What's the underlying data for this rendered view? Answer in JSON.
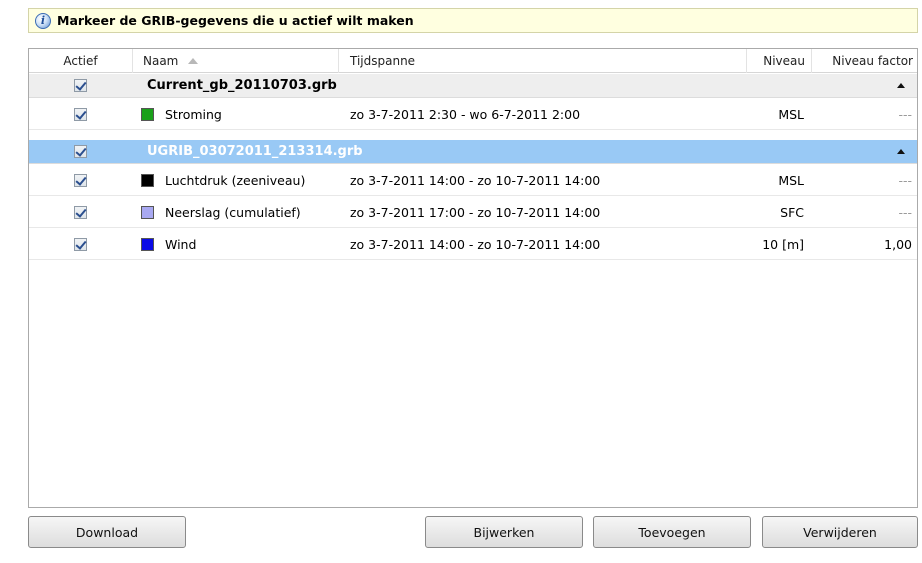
{
  "info": {
    "icon": "info-icon",
    "text": "Markeer de GRIB-gegevens die u actief wilt maken"
  },
  "columns": {
    "actief": "Actief",
    "naam": "Naam",
    "tijdspanne": "Tijdspanne",
    "niveau": "Niveau",
    "niveau_factor": "Niveau factor",
    "sort_indicator": "sort-ascending-icon"
  },
  "groups": [
    {
      "name": "Current_gb_20110703.grb",
      "checked": true,
      "selected": false,
      "rows": [
        {
          "checked": true,
          "color": "#1aa01a",
          "name": "Stroming",
          "tijdspanne": "zo 3-7-2011 2:30 - wo 6-7-2011 2:00",
          "niveau": "MSL",
          "factor": "---"
        }
      ]
    },
    {
      "name": "UGRIB_03072011_213314.grb",
      "checked": true,
      "selected": true,
      "rows": [
        {
          "checked": true,
          "color": "#000000",
          "name": "Luchtdruk (zeeniveau)",
          "tijdspanne": "zo 3-7-2011 14:00 - zo 10-7-2011 14:00",
          "niveau": "MSL",
          "factor": "---"
        },
        {
          "checked": true,
          "color": "#a9a9f2",
          "name": "Neerslag (cumulatief)",
          "tijdspanne": "zo 3-7-2011 17:00 - zo 10-7-2011 14:00",
          "niveau": "SFC",
          "factor": "---"
        },
        {
          "checked": true,
          "color": "#0a0ae6",
          "name": "Wind",
          "tijdspanne": "zo 3-7-2011 14:00 - zo 10-7-2011 14:00",
          "niveau": "10 [m]",
          "factor": "1,00"
        }
      ]
    }
  ],
  "buttons": {
    "download": "Download",
    "bijwerken": "Bijwerken",
    "toevoegen": "Toevoegen",
    "verwijderen": "Verwijderen"
  }
}
